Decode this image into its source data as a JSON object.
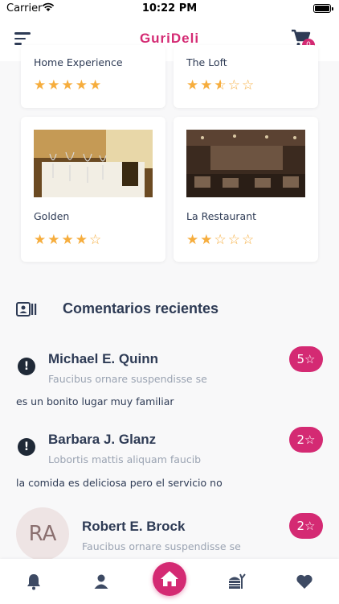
{
  "status_bar": {
    "carrier": "Carrier",
    "time": "10:22 PM"
  },
  "nav": {
    "title": "GuriDeli",
    "cart_count": "0"
  },
  "restaurants": [
    {
      "name": "Home Experience",
      "rating": 5
    },
    {
      "name": "The Loft",
      "rating": 2.5
    },
    {
      "name": "Golden",
      "rating": 4
    },
    {
      "name": "La Restaurant",
      "rating": 2
    }
  ],
  "section": {
    "title": "Comentarios recientes"
  },
  "comments": [
    {
      "name": "Michael E. Quinn",
      "subtitle": "Faucibus ornare suspendisse se",
      "text": "es un bonito lugar muy familiar",
      "rating": "5"
    },
    {
      "name": "Barbara J. Glanz",
      "subtitle": "Lobortis mattis aliquam faucib",
      "text": "la comida es deliciosa pero el servicio no",
      "rating": "2"
    },
    {
      "name": "Robert E. Brock",
      "subtitle": "Faucibus ornare suspendisse se",
      "text": "",
      "rating": "2",
      "initials": "RA"
    }
  ],
  "colors": {
    "accent": "#d42a73",
    "star": "#f6ad3d",
    "text": "#2e3b55"
  }
}
